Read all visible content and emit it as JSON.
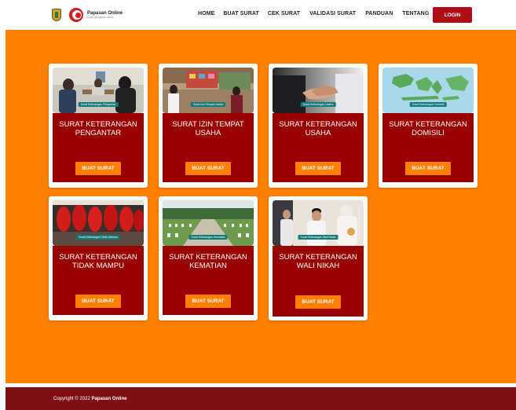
{
  "header": {
    "logo": {
      "title": "Papasan Online",
      "subtitle": "surat pengantar desa"
    },
    "nav": [
      {
        "label": "HOME"
      },
      {
        "label": "BUAT SURAT"
      },
      {
        "label": "CEK SURAT"
      },
      {
        "label": "VALIDASI SURAT"
      },
      {
        "label": "PANDUAN"
      },
      {
        "label": "TENTANG"
      }
    ],
    "login_label": "LOGIN"
  },
  "cards": [
    {
      "title": "SURAT KETERANGAN PENGANTAR",
      "image_caption": "Surat Keterangan Pengantar",
      "button": "BUAT SURAT"
    },
    {
      "title": "SURAT IZIN TEMPAT USAHA",
      "image_caption": "Surat Izin Tempat Usaha",
      "button": "BUAT SURAT"
    },
    {
      "title": "SURAT KETERANGAN USAHA",
      "image_caption": "Surat Keterangan Usaha",
      "button": "BUAT SURAT"
    },
    {
      "title": "SURAT KETERANGAN DOMISILI",
      "image_caption": "Surat Keterangan Domisili",
      "button": "BUAT SURAT"
    },
    {
      "title": "SURAT KETERANGAN TIDAK MAMPU",
      "image_caption": "Surat Keterangan Tidak Mampu",
      "button": "BUAT SURAT"
    },
    {
      "title": "SURAT KETERANGAN KEMATIAN",
      "image_caption": "Surat Keterangan Kematian",
      "button": "BUAT SURAT"
    },
    {
      "title": "SURAT KETERANGAN WALI NIKAH",
      "image_caption": "Surat Keterangan Wali Nikah",
      "button": "BUAT SURAT"
    }
  ],
  "footer": {
    "prefix": "Copyright © 2022 ",
    "brand": "Papasan Online"
  },
  "colors": {
    "main_bg": "#ff7f00",
    "card_body": "#990000",
    "login_button": "#b00e16",
    "footer_bg": "#7f0f14",
    "button_bg": "#ff7f00"
  }
}
